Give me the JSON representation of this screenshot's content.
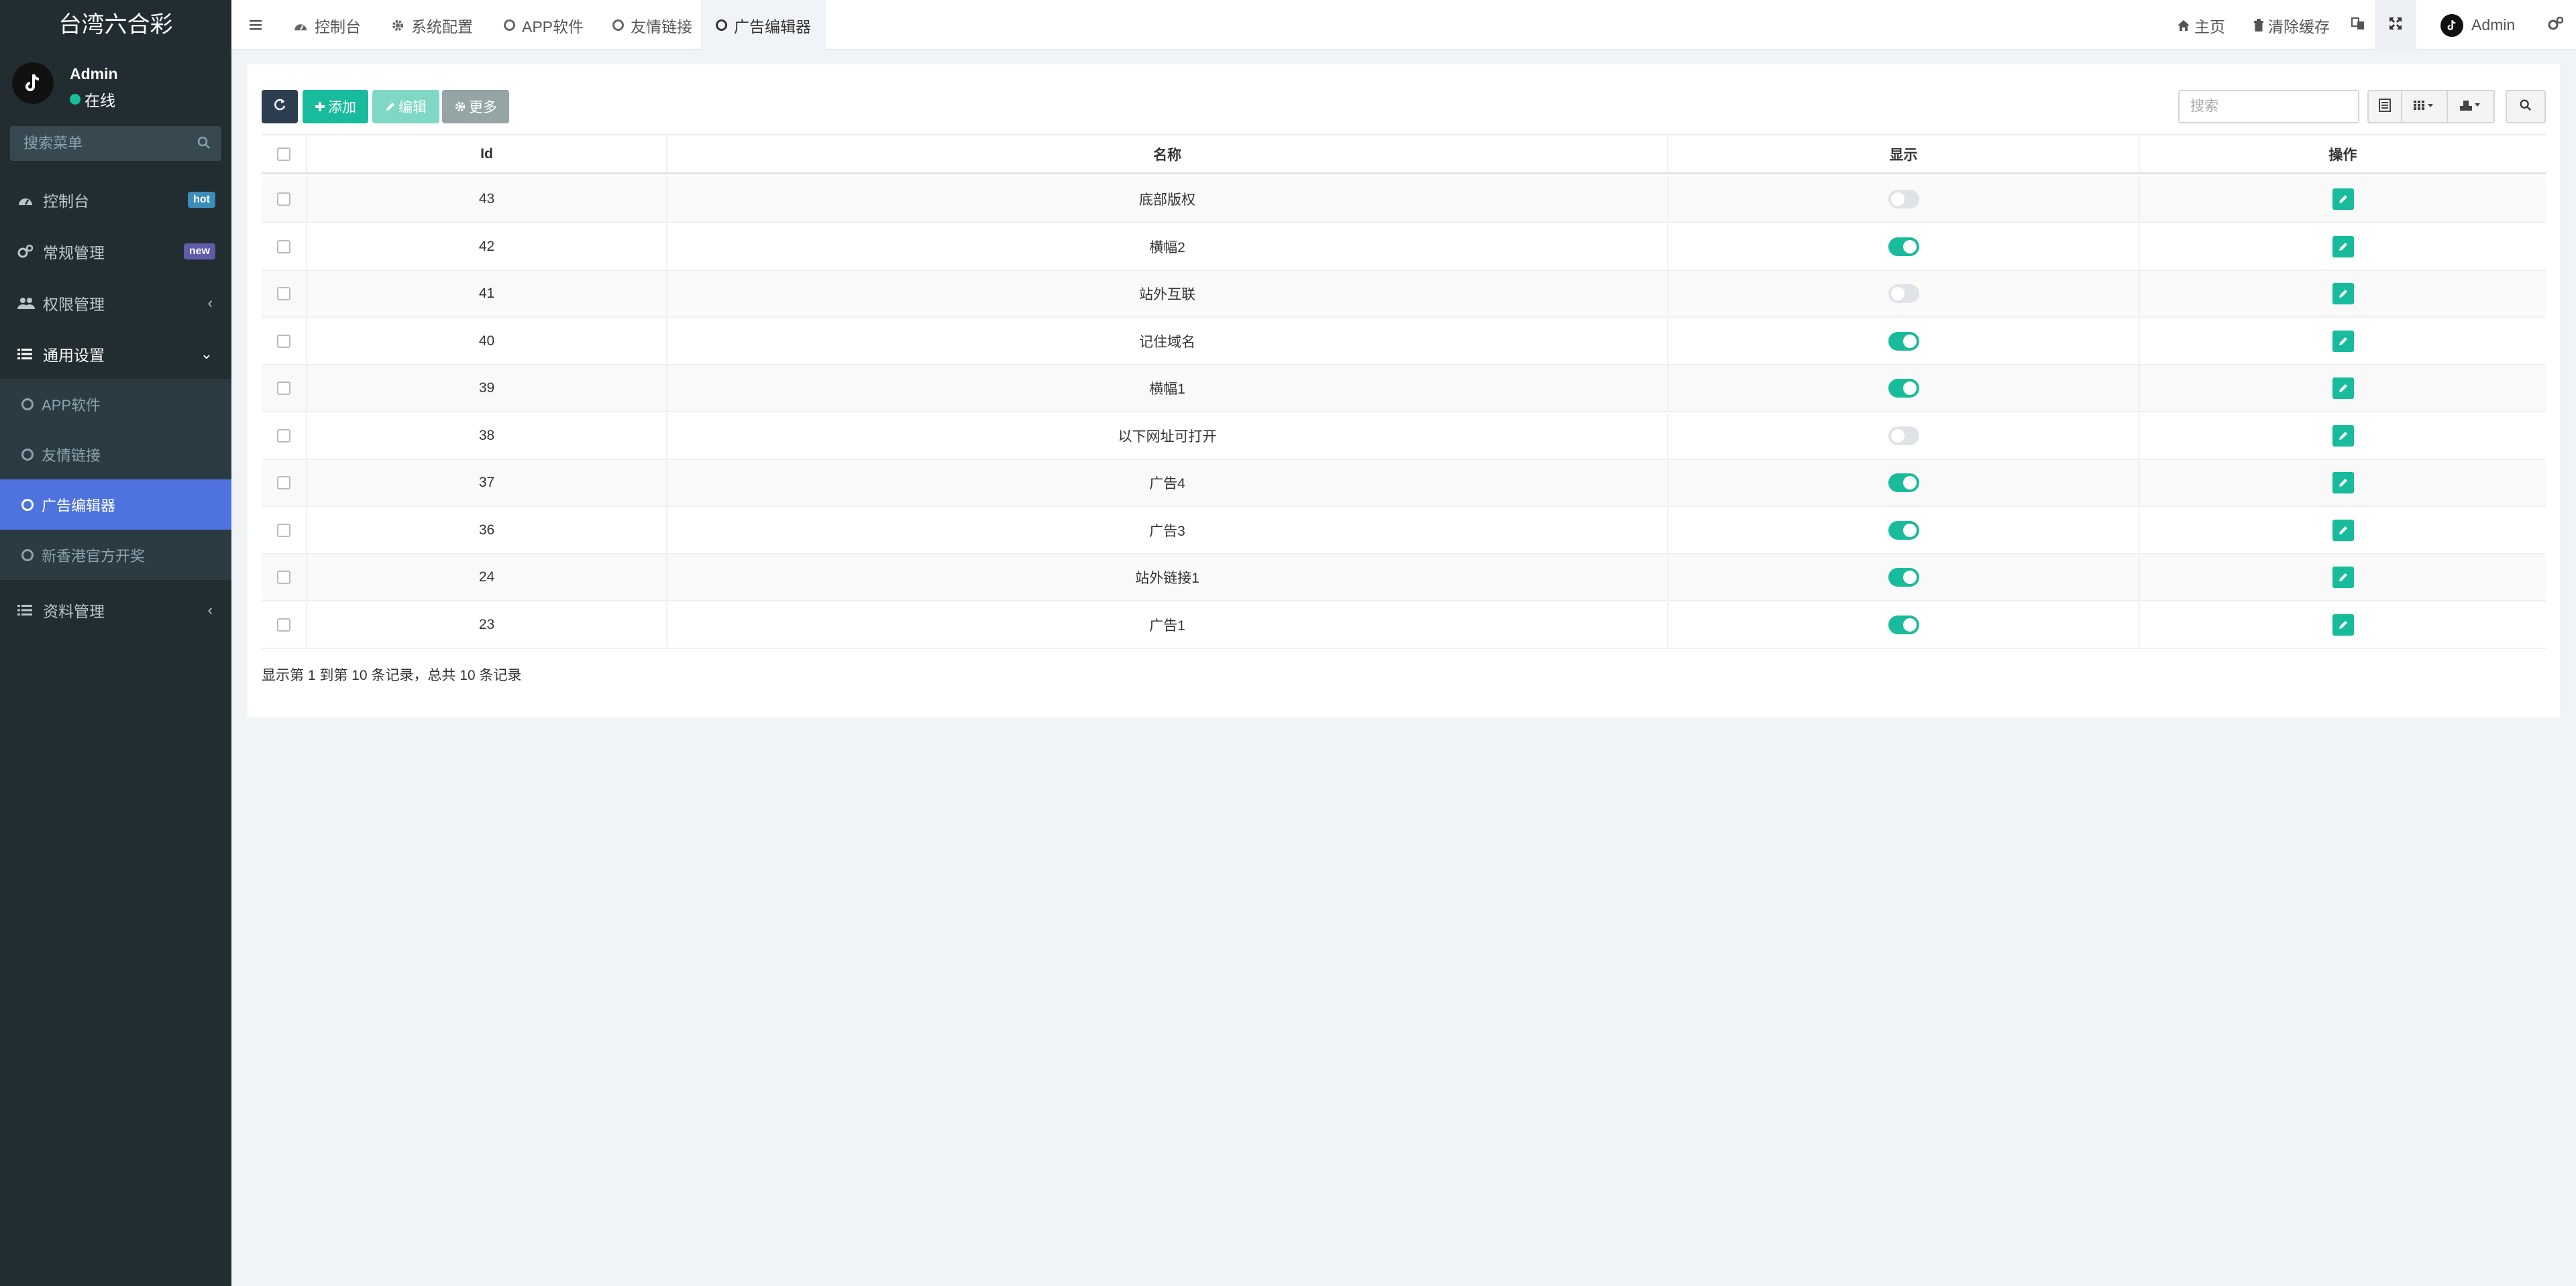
{
  "sidebar": {
    "logo": "台湾六合彩",
    "user_name": "Admin",
    "user_status": "在线",
    "search_placeholder": "搜索菜单",
    "menu": [
      {
        "label": "控制台",
        "badge": "hot",
        "badge_color": "#3c8dbc"
      },
      {
        "label": "常规管理",
        "badge": "new",
        "badge_color": "#605ca8"
      },
      {
        "label": "权限管理",
        "chevron": "‹"
      },
      {
        "label": "通用设置",
        "chevron": "⌄"
      },
      {
        "label": "资料管理",
        "chevron": "‹"
      }
    ],
    "submenu": [
      {
        "label": "APP软件"
      },
      {
        "label": "友情链接"
      },
      {
        "label": "广告编辑器"
      },
      {
        "label": "新香港官方开奖"
      }
    ]
  },
  "topbar": {
    "tabs": [
      {
        "label": "控制台",
        "icon": "dashboard-icon"
      },
      {
        "label": "系统配置",
        "icon": "gear-icon"
      },
      {
        "label": "APP软件",
        "icon": "circle-icon"
      },
      {
        "label": "友情链接",
        "icon": "circle-icon"
      },
      {
        "label": "广告编辑器",
        "icon": "circle-icon"
      }
    ],
    "home": "主页",
    "clear_cache": "清除缓存",
    "user": "Admin"
  },
  "toolbar": {
    "add": "添加",
    "edit": "编辑",
    "more": "更多",
    "search_placeholder": "搜索",
    "colors": {
      "refresh": "#2c3e50",
      "add": "#18bc9c",
      "edit": "#7fd8c6",
      "more": "#95a5a6"
    }
  },
  "table": {
    "headers": {
      "id": "Id",
      "name": "名称",
      "show": "显示",
      "action": "操作"
    },
    "rows": [
      {
        "id": "43",
        "name": "底部版权",
        "show": false
      },
      {
        "id": "42",
        "name": "横幅2",
        "show": true
      },
      {
        "id": "41",
        "name": "站外互联",
        "show": false
      },
      {
        "id": "40",
        "name": "记住域名",
        "show": true
      },
      {
        "id": "39",
        "name": "横幅1",
        "show": true
      },
      {
        "id": "38",
        "name": "以下网址可打开",
        "show": false
      },
      {
        "id": "37",
        "name": "广告4",
        "show": true
      },
      {
        "id": "36",
        "name": "广告3",
        "show": true
      },
      {
        "id": "24",
        "name": "站外链接1",
        "show": true
      },
      {
        "id": "23",
        "name": "广告1",
        "show": true
      }
    ]
  },
  "pagination": {
    "info": "显示第 1 到第 10 条记录，总共 10 条记录"
  }
}
